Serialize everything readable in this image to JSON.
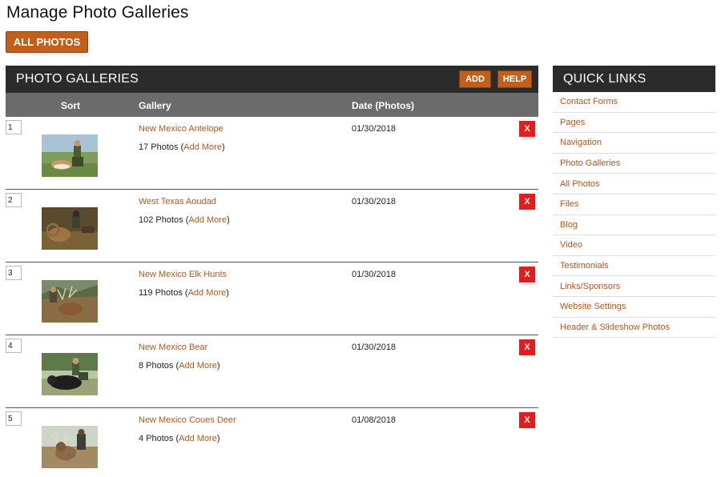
{
  "page_title": "Manage Photo Galleries",
  "all_photos_label": "ALL PHOTOS",
  "panel": {
    "title": "PHOTO GALLERIES",
    "add_label": "ADD",
    "help_label": "HELP",
    "columns": {
      "sort": "Sort",
      "gallery": "Gallery",
      "date": "Date (Photos)"
    }
  },
  "galleries": [
    {
      "sort": "1",
      "name": "New Mexico Antelope",
      "count_text": "17 Photos (",
      "add_more": "Add More",
      "close_paren": ")",
      "date": "01/30/2018",
      "delete_label": "X",
      "thumb": "antelope-hunter-photo"
    },
    {
      "sort": "2",
      "name": "West Texas Aoudad",
      "count_text": "102 Photos (",
      "add_more": "Add More",
      "close_paren": ")",
      "date": "01/30/2018",
      "delete_label": "X",
      "thumb": "aoudad-hunter-photo"
    },
    {
      "sort": "3",
      "name": "New Mexico Elk Hunts",
      "count_text": "119 Photos (",
      "add_more": "Add More",
      "close_paren": ")",
      "date": "01/30/2018",
      "delete_label": "X",
      "thumb": "elk-hunter-photo"
    },
    {
      "sort": "4",
      "name": "New Mexico Bear",
      "count_text": "8 Photos (",
      "add_more": "Add More",
      "close_paren": ")",
      "date": "01/30/2018",
      "delete_label": "X",
      "thumb": "bear-hunter-photo"
    },
    {
      "sort": "5",
      "name": "New Mexico Coues Deer",
      "count_text": "4 Photos (",
      "add_more": "Add More",
      "close_paren": ")",
      "date": "01/08/2018",
      "delete_label": "X",
      "thumb": "coues-deer-hunter-photo"
    }
  ],
  "quick_links": {
    "title": "QUICK LINKS",
    "items": [
      "Contact Forms",
      "Pages",
      "Navigation",
      "Photo Galleries",
      "All Photos",
      "Files",
      "Blog",
      "Video",
      "Testimonials",
      "Links/Sponsors",
      "Website Settings",
      "Header & Slideshow Photos"
    ]
  },
  "colors": {
    "accent": "#c0601a",
    "link": "#b5561a",
    "header_dark": "#2b2b2b",
    "column_header": "#6b6b6b",
    "delete_red": "#e41c1c"
  }
}
